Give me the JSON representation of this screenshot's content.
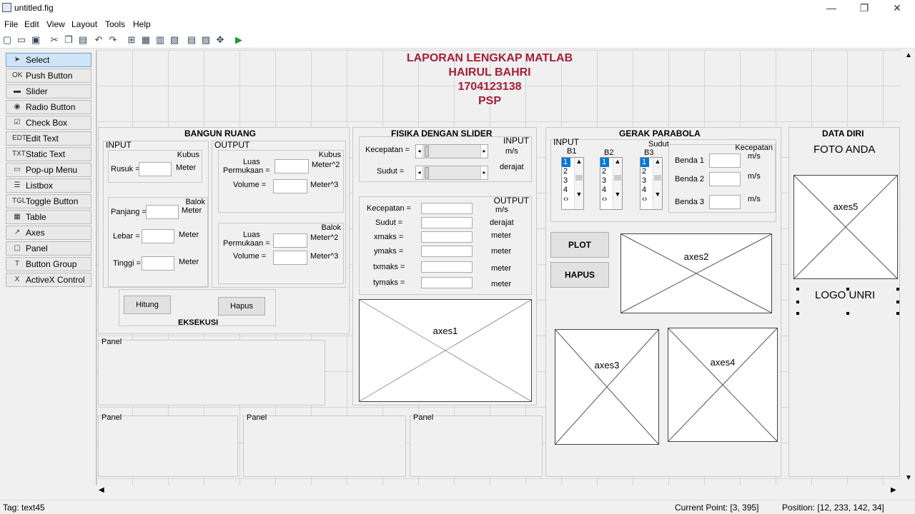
{
  "window": {
    "title": "untitled.fig",
    "minimize": "—",
    "restore": "❐",
    "close": "✕"
  },
  "menu": [
    "File",
    "Edit",
    "View",
    "Layout",
    "Tools",
    "Help"
  ],
  "palette": [
    {
      "label": "Select",
      "icon": "arrow-icon",
      "glyph": "➤"
    },
    {
      "label": "Push Button",
      "icon": "push-button-icon",
      "glyph": "OK"
    },
    {
      "label": "Slider",
      "icon": "slider-icon",
      "glyph": "▬"
    },
    {
      "label": "Radio Button",
      "icon": "radio-icon",
      "glyph": "◉"
    },
    {
      "label": "Check Box",
      "icon": "checkbox-icon",
      "glyph": "☑"
    },
    {
      "label": "Edit Text",
      "icon": "edit-text-icon",
      "glyph": "EDT"
    },
    {
      "label": "Static Text",
      "icon": "static-text-icon",
      "glyph": "TXT"
    },
    {
      "label": "Pop-up Menu",
      "icon": "popup-menu-icon",
      "glyph": "▭"
    },
    {
      "label": "Listbox",
      "icon": "listbox-icon",
      "glyph": "☰"
    },
    {
      "label": "Toggle Button",
      "icon": "toggle-icon",
      "glyph": "TGL"
    },
    {
      "label": "Table",
      "icon": "table-icon",
      "glyph": "▦"
    },
    {
      "label": "Axes",
      "icon": "axes-icon",
      "glyph": "↗"
    },
    {
      "label": "Panel",
      "icon": "panel-icon",
      "glyph": "▢"
    },
    {
      "label": "Button Group",
      "icon": "button-group-icon",
      "glyph": "T"
    },
    {
      "label": "ActiveX Control",
      "icon": "activex-icon",
      "glyph": "X"
    }
  ],
  "header": {
    "line1": "LAPORAN LENGKAP MATLAB",
    "line2": "HAIRUL BAHRI",
    "line3": "1704123138",
    "line4": "PSP",
    "color": "#a31f34"
  },
  "bangun": {
    "title": "BANGUN RUANG",
    "input": "INPUT",
    "output": "OUTPUT",
    "kubus": "Kubus",
    "balok": "Balok",
    "rusuk": "Rusuk =",
    "meter": "Meter",
    "panjang": "Panjang =",
    "lebar": "Lebar =",
    "tinggi": "Tinggi =",
    "luas1": "Luas",
    "luas2": "Permukaan =",
    "meter2": "Meter^2",
    "volume": "Volume =",
    "meter3": "Meter^3",
    "hitung": "Hitung",
    "hapus": "Hapus",
    "eksekusi": "EKSEKUSI"
  },
  "fisika": {
    "title": "FISIKA DENGAN SLIDER",
    "input": "INPUT",
    "output": "OUTPUT",
    "kecepatan": "Kecepatan =",
    "sudut": "Sudut =",
    "ms": "m/s",
    "derajat": "derajat",
    "xmaks": "xmaks =",
    "ymaks": "ymaks =",
    "txmaks": "txmaks =",
    "tymaks": "tymaks =",
    "meter": "meter"
  },
  "parabola": {
    "title": "GERAK  PARABOLA",
    "input": "INPUT",
    "b1": "B1",
    "b2": "B2",
    "b3": "B3",
    "sudut": "Sudut",
    "kecepatan": "Kecepatan",
    "benda1": "Benda 1",
    "benda2": "Benda 2",
    "benda3": "Benda 3",
    "ms": "m/s",
    "list": [
      "1",
      "2",
      "3",
      "4"
    ],
    "dots": "‹›",
    "plot": "PLOT",
    "hapus": "HAPUS"
  },
  "dataDiri": {
    "title": "DATA DIRI",
    "foto": "FOTO ANDA",
    "logo": "LOGO UNRI"
  },
  "axes": {
    "a1": "axes1",
    "a2": "axes2",
    "a3": "axes3",
    "a4": "axes4",
    "a5": "axes5"
  },
  "panel": "Panel",
  "status": {
    "tag": "Tag: text45",
    "point": "Current Point:  [3, 395]",
    "position": "Position: [12, 233, 142, 34]"
  }
}
